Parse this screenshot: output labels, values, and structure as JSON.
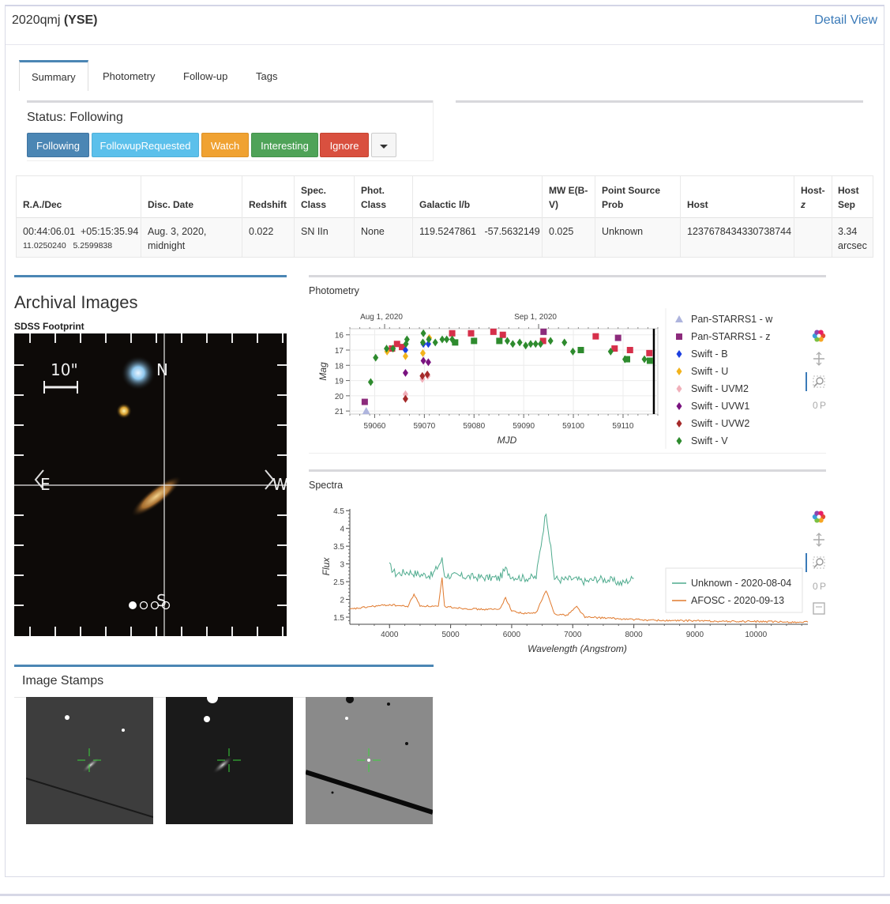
{
  "header": {
    "object_name": "2020qmj",
    "survey": "(YSE)",
    "detail_link": "Detail View"
  },
  "tabs": [
    {
      "label": "Summary"
    },
    {
      "label": "Photometry"
    },
    {
      "label": "Follow-up"
    },
    {
      "label": "Tags"
    }
  ],
  "status": {
    "label": "Status: Following",
    "buttons": {
      "following": "Following",
      "followup_requested": "FollowupRequested",
      "watch": "Watch",
      "interesting": "Interesting",
      "ignore": "Ignore"
    }
  },
  "info_table": {
    "headers": {
      "radec": "R.A./Dec",
      "disc_date": "Disc. Date",
      "redshift": "Redshift",
      "spec_class_1": "Spec.",
      "spec_class_2": "Class",
      "phot_class_1": "Phot.",
      "phot_class_2": "Class",
      "galactic": "Galactic l/b",
      "mwebv_1": "MW E(B-",
      "mwebv_2": "V)",
      "psprob_1": "Point Source",
      "psprob_2": "Prob",
      "host": "Host",
      "hostz_1": "Host-",
      "hostz_2": "z",
      "hostsep_1": "Host",
      "hostsep_2": "Sep"
    },
    "row": {
      "ra_sex": "00:44:06.01",
      "dec_sex": "+05:15:35.94",
      "ra_deg": "11.0250240",
      "dec_deg": "5.2599838",
      "disc_date_1": "Aug. 3, 2020,",
      "disc_date_2": "midnight",
      "redshift": "0.022",
      "spec_class": "SN IIn",
      "phot_class": "None",
      "gal_l": "119.5247861",
      "gal_b": "-57.5632149",
      "mwebv": "0.025",
      "psprob": "Unknown",
      "host": "1237678434330738744",
      "hostz": "",
      "hostsep_1": "3.34",
      "hostsep_2": "arcsec"
    }
  },
  "archival": {
    "title": "Archival Images",
    "footprint_label": "SDSS Footprint",
    "scale_label": "10\"",
    "compass": {
      "n": "N",
      "s": "S",
      "e": "E",
      "w": "W"
    }
  },
  "photometry": {
    "title": "Photometry"
  },
  "spectra": {
    "title": "Spectra"
  },
  "stamps": {
    "title": "Image Stamps"
  },
  "colors": {
    "primary": "#4b86b4",
    "info": "#5bc0eb",
    "warning": "#f0a232",
    "success": "#4fa358",
    "danger": "#d9503f",
    "link": "#3a7ab8"
  },
  "chart_data": [
    {
      "type": "scatter",
      "title": "",
      "xlabel": "MJD",
      "ylabel": "Mag",
      "xlim": [
        59055,
        59117
      ],
      "ylim": [
        21.2,
        15.6
      ],
      "x_ticks": [
        59060,
        59070,
        59080,
        59090,
        59100,
        59110
      ],
      "y_ticks": [
        16,
        17,
        18,
        19,
        20,
        21
      ],
      "top_axis_labels": [
        {
          "label": "Aug 1, 2020",
          "x": 59062
        },
        {
          "label": "Sep 1, 2020",
          "x": 59093
        }
      ],
      "vline_x": 59116.2,
      "legend_position": "right",
      "series": [
        {
          "name": "Pan-STARRS1 - w",
          "marker": "triangle",
          "color": "#aeb4dd",
          "points": [
            [
              59058.3,
              21.0
            ]
          ]
        },
        {
          "name": "Pan-STARRS1 - z",
          "marker": "square",
          "color": "#8c2b7c",
          "points": [
            [
              59058,
              20.4
            ],
            [
              59094,
              15.8
            ],
            [
              59109,
              16.2
            ]
          ]
        },
        {
          "name": "Swift - B",
          "marker": "diamond",
          "color": "#1c3fe0",
          "points": [
            [
              59066.2,
              17.0
            ],
            [
              59069.8,
              16.6
            ],
            [
              59070.8,
              16.6
            ]
          ]
        },
        {
          "name": "Swift - U",
          "marker": "diamond",
          "color": "#f2b31c",
          "points": [
            [
              59062.5,
              17.1
            ],
            [
              59066.2,
              17.4
            ],
            [
              59069.7,
              17.2
            ],
            [
              59071,
              16.2
            ]
          ]
        },
        {
          "name": "Swift - UVM2",
          "marker": "diamond",
          "color": "#f1b0ba",
          "points": [
            [
              59066.2,
              19.9
            ],
            [
              59069.6,
              18.9
            ],
            [
              59070.7,
              18.7
            ]
          ]
        },
        {
          "name": "Swift - UVW1",
          "marker": "diamond",
          "color": "#7a1380",
          "points": [
            [
              59066.2,
              18.5
            ],
            [
              59069.8,
              17.7
            ],
            [
              59070.8,
              17.8
            ]
          ]
        },
        {
          "name": "Swift - UVW2",
          "marker": "diamond",
          "color": "#a52a2a",
          "points": [
            [
              59066.2,
              20.2
            ],
            [
              59069.6,
              18.7
            ],
            [
              59070.6,
              18.6
            ]
          ]
        },
        {
          "name": "Swift - V",
          "marker": "diamond",
          "color": "#2e8b2e",
          "points": [
            [
              59059.2,
              19.1
            ],
            [
              59060.2,
              17.5
            ],
            [
              59062.4,
              16.9
            ],
            [
              59063.7,
              16.9
            ],
            [
              59066.3,
              16.6
            ],
            [
              59066.5,
              16.3
            ],
            [
              59069.7,
              16.5
            ],
            [
              59069.8,
              15.9
            ],
            [
              59070.9,
              16.3
            ],
            [
              59072.2,
              16.5
            ],
            [
              59073.6,
              16.3
            ],
            [
              59074.5,
              16.3
            ],
            [
              59075.6,
              16.3
            ],
            [
              59086.7,
              16.4
            ],
            [
              59087.8,
              16.6
            ],
            [
              59089.2,
              16.5
            ],
            [
              59090.4,
              16.7
            ],
            [
              59091.4,
              16.6
            ],
            [
              59092.4,
              16.6
            ],
            [
              59093.4,
              16.6
            ],
            [
              59095.4,
              16.4
            ],
            [
              59098.2,
              16.5
            ],
            [
              59099.9,
              17.1
            ],
            [
              59107.5,
              17.1
            ],
            [
              59110.4,
              17.6
            ],
            [
              59114.3,
              17.6
            ]
          ]
        }
      ],
      "series_extra": [
        {
          "series": "Pan-STARRS1 - z (red-ish)",
          "color": "#d62f4a",
          "points": [
            [
              59063.5,
              16.9
            ],
            [
              59064.5,
              16.6
            ],
            [
              59065.5,
              16.8
            ],
            [
              59075.6,
              15.9
            ],
            [
              59079.4,
              15.9
            ],
            [
              59083.9,
              15.8
            ],
            [
              59085.8,
              16.0
            ],
            [
              59093.9,
              16.4
            ],
            [
              59104.5,
              16.1
            ],
            [
              59108.3,
              16.9
            ],
            [
              59111.4,
              17.0
            ],
            [
              59115.3,
              17.2
            ]
          ]
        },
        {
          "series": "Pan-STARRS1 - w (boxes)",
          "color": "#2e8b2e",
          "points": [
            [
              59076.2,
              16.5
            ],
            [
              59080.0,
              16.4
            ],
            [
              59085.1,
              16.4
            ],
            [
              59101.5,
              17.0
            ],
            [
              59110.8,
              17.6
            ],
            [
              59115.4,
              17.7
            ]
          ]
        }
      ]
    },
    {
      "type": "line",
      "title": "",
      "xlabel": "Wavelength (Angstrom)",
      "ylabel": "Flux",
      "xlim": [
        3350,
        10850
      ],
      "ylim": [
        1.3,
        4.55
      ],
      "x_ticks": [
        4000,
        5000,
        6000,
        7000,
        8000,
        9000,
        10000
      ],
      "y_ticks": [
        1.5,
        2,
        2.5,
        3,
        3.5,
        4,
        4.5
      ],
      "legend_position": "bottom-right",
      "series": [
        {
          "name": "Unknown - 2020-08-04",
          "color": "#4fab8e",
          "x": [
            3998,
            4100,
            4300,
            4500,
            4700,
            4860,
            4900,
            5200,
            5500,
            5800,
            5900,
            6000,
            6200,
            6400,
            6563,
            6700,
            6800,
            7000,
            7200,
            7400,
            7600,
            7800,
            8000
          ],
          "y": [
            2.95,
            2.72,
            2.78,
            2.7,
            2.68,
            3.12,
            2.68,
            2.65,
            2.62,
            2.6,
            2.85,
            2.65,
            2.6,
            2.62,
            4.5,
            2.6,
            2.55,
            2.58,
            2.5,
            2.58,
            2.55,
            2.45,
            2.6
          ]
        },
        {
          "name": "AFOSC - 2020-09-13",
          "color": "#e07a2e",
          "x": [
            3350,
            3700,
            4000,
            4300,
            4400,
            4500,
            4800,
            4860,
            4900,
            5200,
            5500,
            5800,
            5900,
            6000,
            6200,
            6400,
            6563,
            6700,
            6900,
            7065,
            7200,
            7500,
            7800,
            8200,
            8600,
            9000,
            9500,
            10000,
            10500,
            10850
          ],
          "y": [
            1.72,
            1.8,
            1.85,
            1.8,
            2.15,
            1.82,
            1.8,
            2.6,
            1.8,
            1.75,
            1.72,
            1.72,
            2.05,
            1.68,
            1.6,
            1.62,
            2.25,
            1.6,
            1.55,
            1.8,
            1.5,
            1.48,
            1.45,
            1.42,
            1.4,
            1.4,
            1.38,
            1.38,
            1.36,
            1.36
          ]
        }
      ]
    }
  ]
}
